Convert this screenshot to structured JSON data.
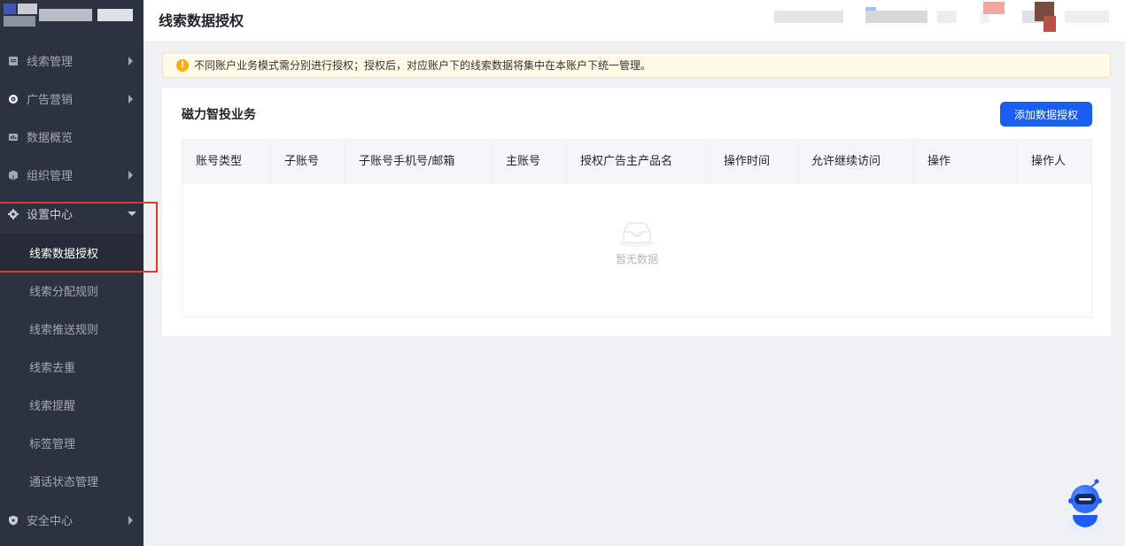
{
  "header": {
    "page_title": "线索数据授权"
  },
  "sidebar": {
    "items": [
      {
        "label": "线索管理",
        "icon": "clipboard-icon"
      },
      {
        "label": "广告营销",
        "icon": "target-icon"
      },
      {
        "label": "数据概览",
        "icon": "chart-icon"
      },
      {
        "label": "组织管理",
        "icon": "cube-icon"
      },
      {
        "label": "设置中心",
        "icon": "gear-icon"
      },
      {
        "label": "安全中心",
        "icon": "shield-icon"
      }
    ],
    "sub_items": [
      {
        "label": "线索数据授权"
      },
      {
        "label": "线索分配规则"
      },
      {
        "label": "线索推送规则"
      },
      {
        "label": "线索去重"
      },
      {
        "label": "线索提醒"
      },
      {
        "label": "标签管理"
      },
      {
        "label": "通话状态管理"
      }
    ]
  },
  "alert": {
    "text": "不同账户业务模式需分别进行授权；授权后，对应账户下的线索数据将集中在本账户下统一管理。"
  },
  "card": {
    "title": "磁力智投业务",
    "add_button": "添加数据授权",
    "columns": [
      "账号类型",
      "子账号",
      "子账号手机号/邮箱",
      "主账号",
      "授权广告主产品名",
      "操作时间",
      "允许继续访问",
      "操作",
      "操作人"
    ],
    "empty_text": "暂无数据"
  },
  "colors": {
    "sidebar_bg": "#2d3240",
    "primary": "#1a5ff5",
    "highlight": "#e03a2f",
    "alert_bg": "#fffbe6"
  }
}
